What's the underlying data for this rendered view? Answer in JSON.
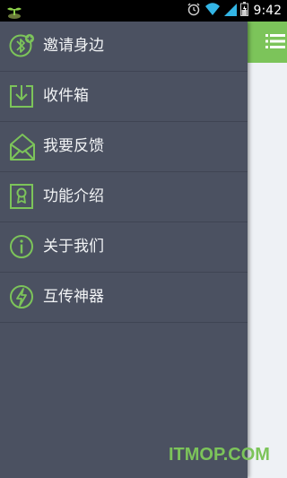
{
  "status_bar": {
    "time": "9:42",
    "icons": [
      "plant-app-icon",
      "alarm-icon",
      "wifi-icon",
      "signal-icon",
      "battery-icon"
    ]
  },
  "drawer": {
    "items": [
      {
        "label": "邀请身边",
        "icon": "bluetooth-add-icon"
      },
      {
        "label": "收件箱",
        "icon": "inbox-download-icon"
      },
      {
        "label": "我要反馈",
        "icon": "envelope-open-icon"
      },
      {
        "label": "功能介绍",
        "icon": "badge-ribbon-icon"
      },
      {
        "label": "关于我们",
        "icon": "info-icon"
      },
      {
        "label": "互传神器",
        "icon": "lightning-icon"
      }
    ]
  },
  "main": {
    "header_menu_icon": "hamburger-icon"
  },
  "watermark": {
    "text": "ITMOP.COM"
  },
  "colors": {
    "accent": "#7cc45a",
    "drawer_bg": "#4b5161",
    "divider": "#3f4453",
    "text": "#f1f3f5"
  }
}
